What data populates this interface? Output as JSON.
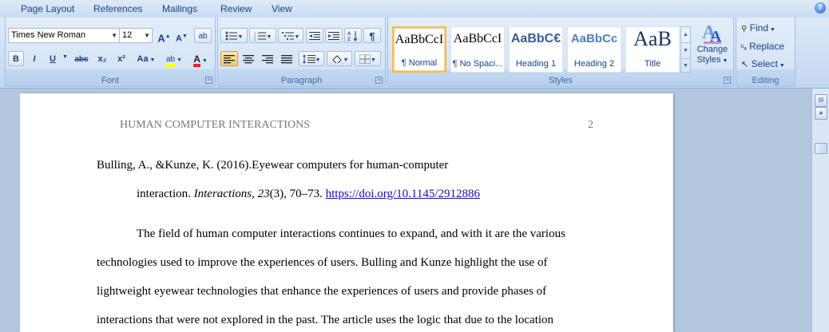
{
  "tabs": [
    "Page Layout",
    "References",
    "Mailings",
    "Review",
    "View"
  ],
  "help_label": "?",
  "font": {
    "name": "Times New Roman",
    "size": "12",
    "grow_label": "A",
    "shrink_label": "A",
    "clear_label": "ab",
    "bold": "B",
    "italic": "I",
    "underline": "U",
    "strike": "abc",
    "subscript": "x₂",
    "superscript": "x²",
    "case": "Aa",
    "highlight": "ab",
    "color": "A",
    "group_label": "Font"
  },
  "paragraph": {
    "group_label": "Paragraph",
    "pilcrow": "¶"
  },
  "styles": {
    "group_label": "Styles",
    "items": [
      {
        "sample": "AaBbCcI",
        "name": "¶ Normal",
        "selected": true
      },
      {
        "sample": "AaBbCcI",
        "name": "¶ No Spaci...",
        "selected": false
      },
      {
        "sample": "AaBbC€",
        "name": "Heading 1",
        "selected": false
      },
      {
        "sample": "AaBbCc",
        "name": "Heading 2",
        "selected": false
      },
      {
        "sample": "AaB",
        "name": "Title",
        "selected": false
      }
    ],
    "change_styles": [
      "Change",
      "Styles"
    ]
  },
  "editing": {
    "group_label": "Editing",
    "find": "Find",
    "replace": "Replace",
    "select": "Select"
  },
  "document": {
    "running_head": "HUMAN COMPUTER INTERACTIONS",
    "page_number": "2",
    "ref_line1": "Bulling, A., &Kunze, K. (2016).Eyewear computers for human-computer",
    "ref_line2_plain": "interaction. ",
    "ref_line2_journal": "Interactions",
    "ref_line2_sep": ",  ",
    "ref_line2_volume": "23",
    "ref_line2_rest": "(3), 70–73. ",
    "ref_line2_doi": "https://doi.org/10.1145/2912886",
    "para_lines": [
      "The field of human computer interactions continues to expand, and with it are the various",
      "technologies used to improve the experiences of users. Bulling and Kunze highlight the use of",
      "lightweight eyewear technologies that enhance the experiences of users and provide phases of",
      "interactions that were not explored in the past. The article uses the logic that due to the location"
    ]
  }
}
